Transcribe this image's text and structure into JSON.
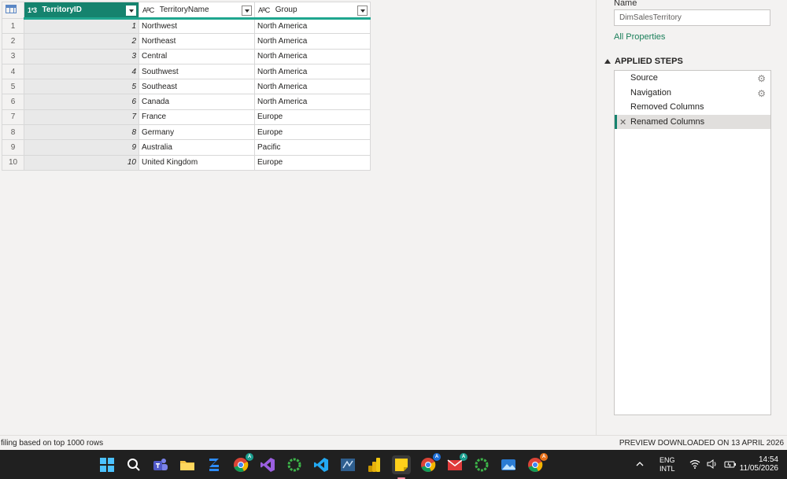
{
  "table": {
    "columns": [
      {
        "name": "TerritoryID",
        "type_icon": "1²3"
      },
      {
        "name": "TerritoryName",
        "type_icon": "AᴮC"
      },
      {
        "name": "Group",
        "type_icon": "AᴮC"
      }
    ],
    "rows": [
      {
        "n": "1",
        "id": "1",
        "name": "Northwest",
        "group": "North America"
      },
      {
        "n": "2",
        "id": "2",
        "name": "Northeast",
        "group": "North America"
      },
      {
        "n": "3",
        "id": "3",
        "name": "Central",
        "group": "North America"
      },
      {
        "n": "4",
        "id": "4",
        "name": "Southwest",
        "group": "North America"
      },
      {
        "n": "5",
        "id": "5",
        "name": "Southeast",
        "group": "North America"
      },
      {
        "n": "6",
        "id": "6",
        "name": "Canada",
        "group": "North America"
      },
      {
        "n": "7",
        "id": "7",
        "name": "France",
        "group": "Europe"
      },
      {
        "n": "8",
        "id": "8",
        "name": "Germany",
        "group": "Europe"
      },
      {
        "n": "9",
        "id": "9",
        "name": "Australia",
        "group": "Pacific"
      },
      {
        "n": "10",
        "id": "10",
        "name": "United Kingdom",
        "group": "Europe"
      }
    ]
  },
  "properties": {
    "name_label": "Name",
    "name_value": "DimSalesTerritory",
    "all_properties": "All Properties"
  },
  "applied_steps": {
    "title": "APPLIED STEPS",
    "steps": [
      {
        "label": "Source",
        "has_gear": true,
        "active": false
      },
      {
        "label": "Navigation",
        "has_gear": true,
        "active": false
      },
      {
        "label": "Removed Columns",
        "has_gear": false,
        "active": false
      },
      {
        "label": "Renamed Columns",
        "has_gear": false,
        "active": true
      }
    ]
  },
  "status": {
    "left": "filing based on top 1000 rows",
    "right": "PREVIEW DOWNLOADED ON 13 APRIL 2026"
  },
  "taskbar": {
    "icons": [
      "windows-start-icon",
      "search-icon",
      "teams-icon",
      "file-explorer-icon",
      "zoom-icon",
      "chrome-icon",
      "visual-studio-icon",
      "loading-app-icon",
      "vscode-icon",
      "ssms-icon",
      "power-bi-icon",
      "sticky-notes-icon",
      "chrome-profile-icon",
      "mail-icon",
      "loading-app-icon-2",
      "photos-icon",
      "chrome-profile-2-icon"
    ],
    "lang_top": "ENG",
    "lang_bottom": "INTL",
    "time": "14:54",
    "date": "11/05/2026"
  },
  "colors": {
    "accent": "#15836e",
    "link": "#1a7f5a",
    "taskbar": "#202020"
  }
}
